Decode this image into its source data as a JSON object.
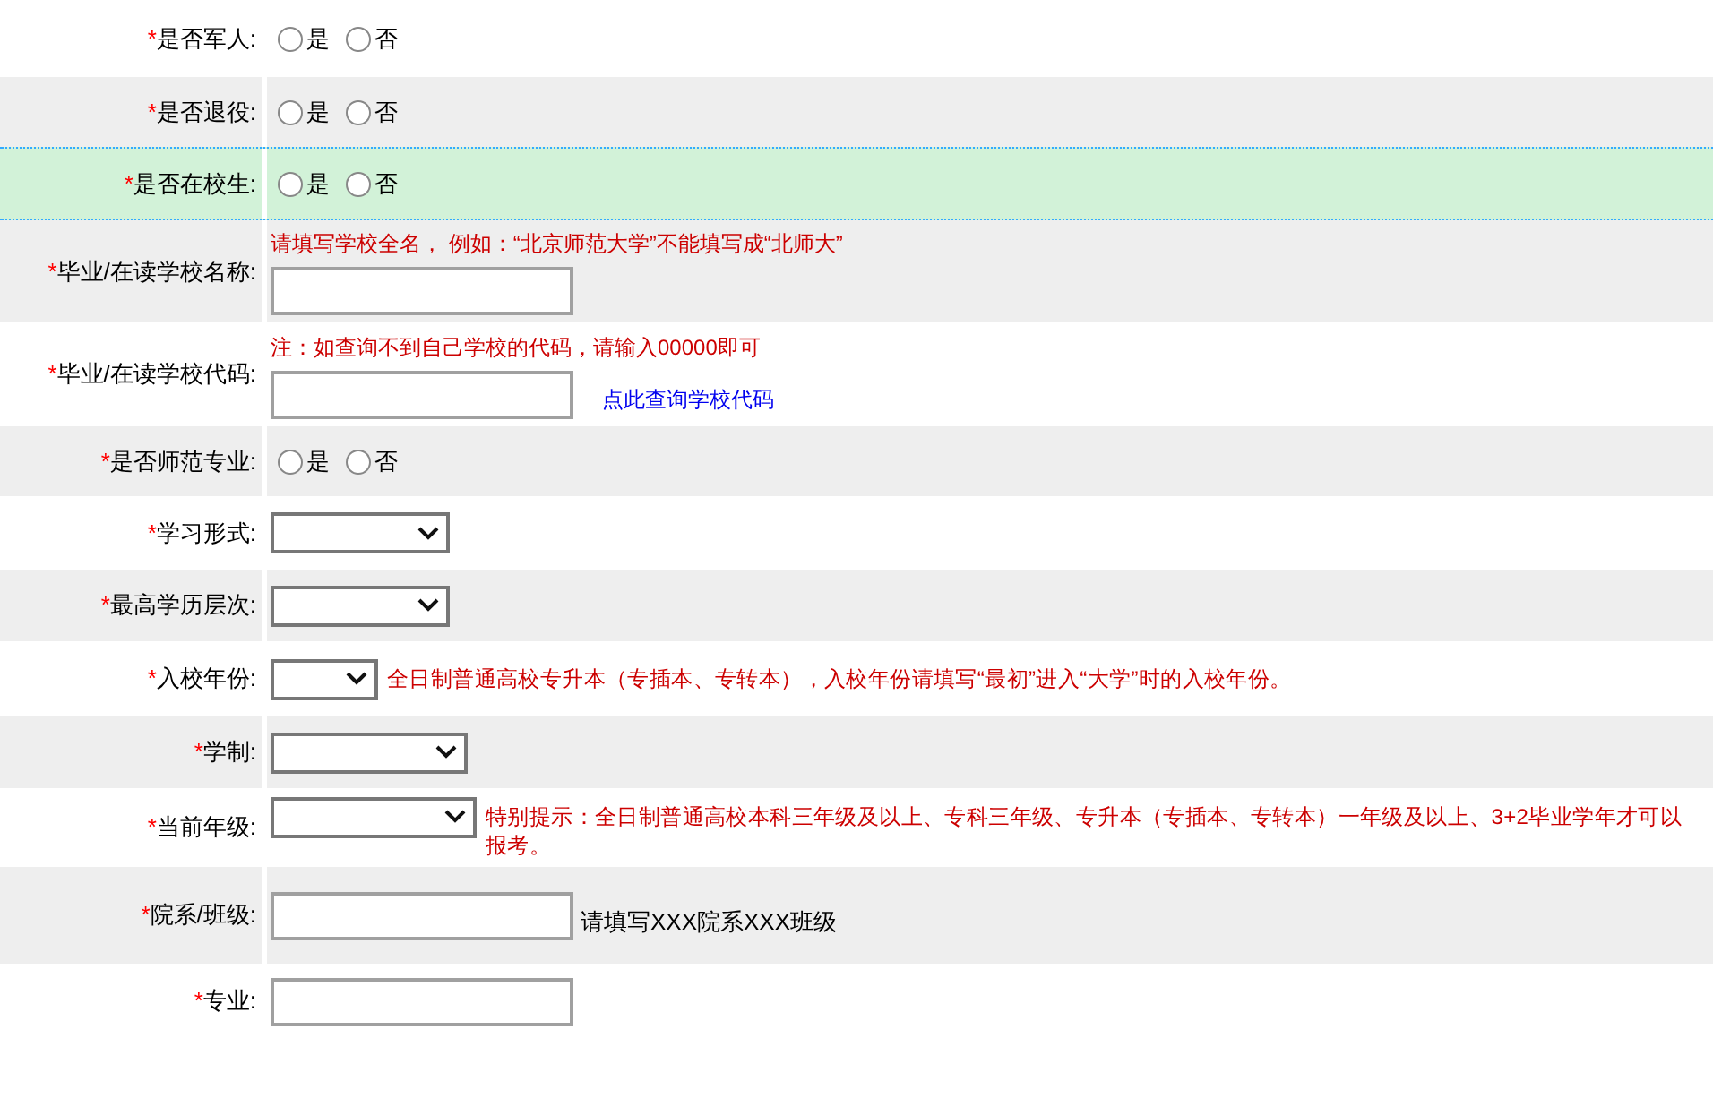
{
  "rows": [
    {
      "label": "是否军人:",
      "required": "*",
      "kind": "radio",
      "highlighted": false,
      "options": [
        {
          "label": "是",
          "selected": false
        },
        {
          "label": "否",
          "selected": false
        }
      ]
    },
    {
      "label": "是否退役:",
      "required": "*",
      "kind": "radio",
      "highlighted": false,
      "options": [
        {
          "label": "是",
          "selected": false
        },
        {
          "label": "否",
          "selected": false
        }
      ]
    },
    {
      "label": "是否在校生:",
      "required": "*",
      "kind": "radio",
      "highlighted": true,
      "options": [
        {
          "label": "是",
          "selected": false
        },
        {
          "label": "否",
          "selected": false
        }
      ]
    },
    {
      "label": "毕业/在读学校名称:",
      "required": "*",
      "kind": "text",
      "highlighted": false,
      "note_above": "请填写学校全名， 例如：“北京师范大学”不能填写成“北师大”"
    },
    {
      "label": "毕业/在读学校代码:",
      "required": "*",
      "kind": "text",
      "highlighted": false,
      "note_above": "注：如查询不到自己学校的代码，请输入00000即可",
      "link": "点此查询学校代码"
    },
    {
      "label": "是否师范专业:",
      "required": "*",
      "kind": "radio",
      "highlighted": false,
      "options": [
        {
          "label": "是",
          "selected": false
        },
        {
          "label": "否",
          "selected": false
        }
      ]
    },
    {
      "label": "学习形式:",
      "required": "*",
      "kind": "select",
      "highlighted": false
    },
    {
      "label": "最高学历层次:",
      "required": "*",
      "kind": "select",
      "highlighted": false
    },
    {
      "label": "入校年份:",
      "required": "*",
      "kind": "select",
      "highlighted": false,
      "note": {
        "text": "全日制普通高校专升本（专插本、专转本），入校年份请填写“最初”进入“大学”时的入校年份。",
        "kind": "warning"
      }
    },
    {
      "label": "学制:",
      "required": "*",
      "kind": "select",
      "highlighted": false
    },
    {
      "label": "当前年级:",
      "required": "*",
      "kind": "select",
      "highlighted": false,
      "note": {
        "text": "特别提示：全日制普通高校本科三年级及以上、专科三年级、专升本（专插本、专转本）一年级及以上、3+2毕业学年才可以报考。",
        "kind": "warning"
      }
    },
    {
      "label": "院系/班级:",
      "required": "*",
      "kind": "text",
      "highlighted": false,
      "note": {
        "text": "请填写XXX院系XXX班级",
        "kind": "hint"
      }
    },
    {
      "label": "专业:",
      "required": "*",
      "kind": "text",
      "highlighted": false
    }
  ]
}
